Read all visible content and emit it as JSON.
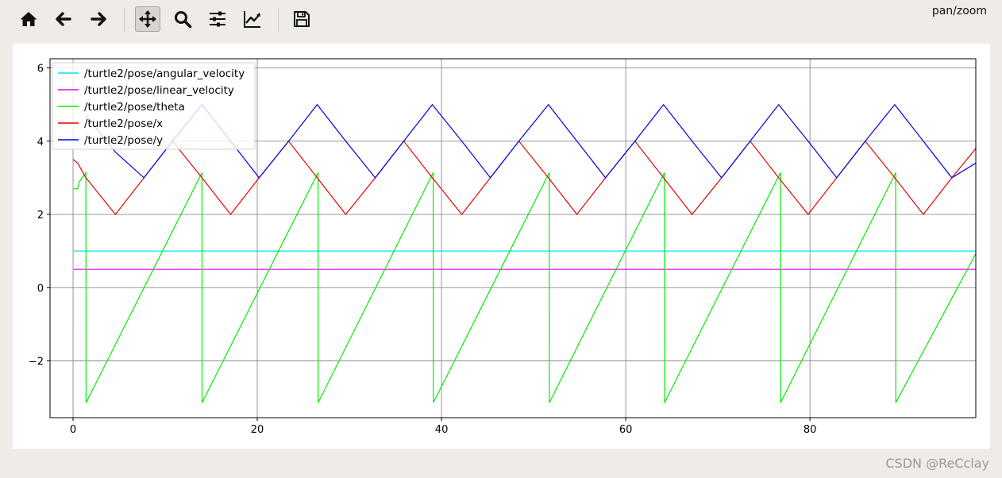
{
  "toolbar": {
    "buttons": [
      {
        "name": "home-button",
        "icon": "home-icon"
      },
      {
        "name": "back-button",
        "icon": "arrow-left-icon"
      },
      {
        "name": "forward-button",
        "icon": "arrow-right-icon"
      },
      {
        "name": "pan-button",
        "icon": "move-icon",
        "active": true
      },
      {
        "name": "zoom-button",
        "icon": "search-icon"
      },
      {
        "name": "configure-subplots-button",
        "icon": "sliders-icon"
      },
      {
        "name": "edit-axis-button",
        "icon": "line-chart-icon"
      },
      {
        "name": "save-button",
        "icon": "save-icon"
      }
    ],
    "mode_label": "pan/zoom"
  },
  "watermark": "CSDN @ReCclay",
  "chart_data": {
    "type": "line",
    "xlim": [
      -2.5,
      98
    ],
    "ylim": [
      -3.55,
      6.25
    ],
    "xticks": [
      0,
      20,
      40,
      60,
      80
    ],
    "yticks": [
      -2,
      0,
      2,
      4,
      6
    ],
    "xtick_labels": [
      "0",
      "20",
      "40",
      "60",
      "80"
    ],
    "ytick_labels": [
      "−2",
      "0",
      "2",
      "4",
      "6"
    ],
    "grid": true,
    "legend_position": "upper-left",
    "series": [
      {
        "name": "/turtle2/pose/angular_velocity",
        "color": "#00e5ee",
        "x": [
          0,
          98
        ],
        "y": [
          1.0,
          1.0
        ]
      },
      {
        "name": "/turtle2/pose/linear_velocity",
        "color": "#ee00ee",
        "x": [
          0,
          98
        ],
        "y": [
          0.5,
          0.5
        ]
      },
      {
        "name": "/turtle2/pose/theta",
        "color": "#00ee00",
        "x": [
          0,
          0.1,
          0.5,
          0.7,
          1.4,
          1.41,
          14.0,
          14.01,
          26.6,
          26.61,
          39.1,
          39.11,
          51.7,
          51.71,
          64.2,
          64.21,
          76.8,
          76.81,
          89.3,
          89.31,
          98.0
        ],
        "y": [
          2.7,
          2.7,
          2.7,
          2.9,
          3.14,
          -3.14,
          3.14,
          -3.14,
          3.14,
          -3.14,
          3.14,
          -3.14,
          3.14,
          -3.14,
          3.14,
          -3.14,
          3.14,
          -3.14,
          3.14,
          -3.14,
          0.93
        ]
      },
      {
        "name": "/turtle2/pose/x",
        "color": "#ee0000",
        "x": [
          0,
          0.5,
          1.4,
          4.6,
          7.7,
          10.8,
          14.0,
          17.1,
          20.2,
          23.4,
          26.5,
          29.6,
          32.8,
          35.9,
          39.0,
          42.2,
          45.3,
          48.4,
          51.6,
          54.7,
          57.8,
          61.0,
          64.1,
          67.2,
          70.4,
          73.5,
          76.6,
          79.8,
          82.9,
          86.0,
          89.2,
          92.3,
          95.4,
          98.0
        ],
        "y": [
          3.5,
          3.4,
          3.0,
          2.0,
          3.0,
          4.0,
          3.0,
          2.0,
          3.0,
          4.0,
          3.0,
          2.0,
          3.0,
          4.0,
          3.0,
          2.0,
          3.0,
          4.0,
          3.0,
          2.0,
          3.0,
          4.0,
          3.0,
          2.0,
          3.0,
          4.0,
          3.0,
          2.0,
          3.0,
          4.0,
          3.0,
          2.0,
          3.0,
          3.8
        ]
      },
      {
        "name": "/turtle2/pose/y",
        "color": "#0000ee",
        "x": [
          1.4,
          4.6,
          7.7,
          10.8,
          14.0,
          17.1,
          20.2,
          23.4,
          26.5,
          29.6,
          32.8,
          35.9,
          39.0,
          42.2,
          45.3,
          48.4,
          51.6,
          54.7,
          57.8,
          61.0,
          64.1,
          67.2,
          70.4,
          73.5,
          76.6,
          79.8,
          82.9,
          86.0,
          89.2,
          92.3,
          95.4,
          98.0
        ],
        "y": [
          4.7,
          3.7,
          3.0,
          4.0,
          5.0,
          4.0,
          3.0,
          4.0,
          5.0,
          4.0,
          3.0,
          4.0,
          5.0,
          4.0,
          3.0,
          4.0,
          5.0,
          4.0,
          3.0,
          4.0,
          5.0,
          4.0,
          3.0,
          4.0,
          5.0,
          4.0,
          3.0,
          4.0,
          5.0,
          4.0,
          3.0,
          3.4
        ]
      }
    ]
  }
}
